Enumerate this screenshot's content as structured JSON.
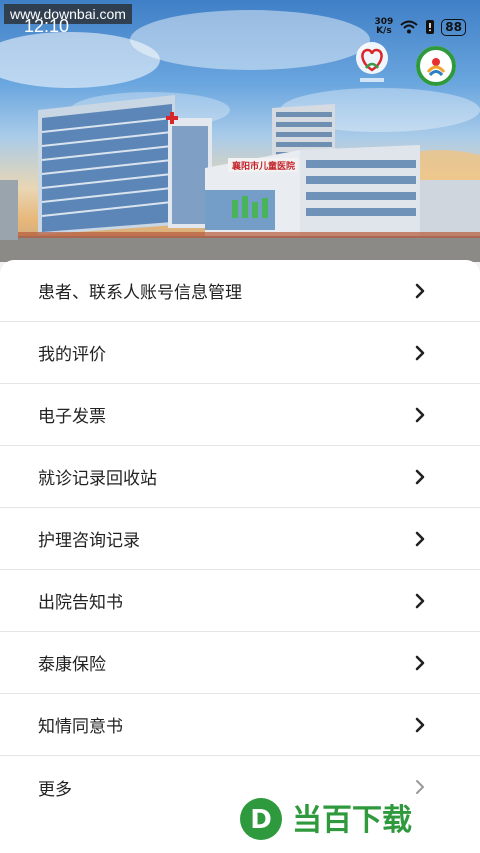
{
  "watermark_top": "www.downbai.com",
  "status_bar": {
    "time": "12:10",
    "net_speed_value": "309",
    "net_speed_unit": "K/s",
    "battery": "88"
  },
  "hero": {
    "building_sign": "襄阳市儿童医院"
  },
  "menu": {
    "items": [
      {
        "label": "患者、联系人账号信息管理"
      },
      {
        "label": "我的评价"
      },
      {
        "label": "电子发票"
      },
      {
        "label": "就诊记录回收站"
      },
      {
        "label": "护理咨询记录"
      },
      {
        "label": "出院告知书"
      },
      {
        "label": "泰康保险"
      },
      {
        "label": "知情同意书"
      },
      {
        "label": "更多"
      }
    ]
  },
  "bottom_watermark": {
    "text": "当百下载",
    "logo_letter": "D",
    "color": "#2e9a3d"
  },
  "colors": {
    "accent_green": "#2e9a3d",
    "text": "#222222",
    "divider": "#e6e6e6"
  }
}
